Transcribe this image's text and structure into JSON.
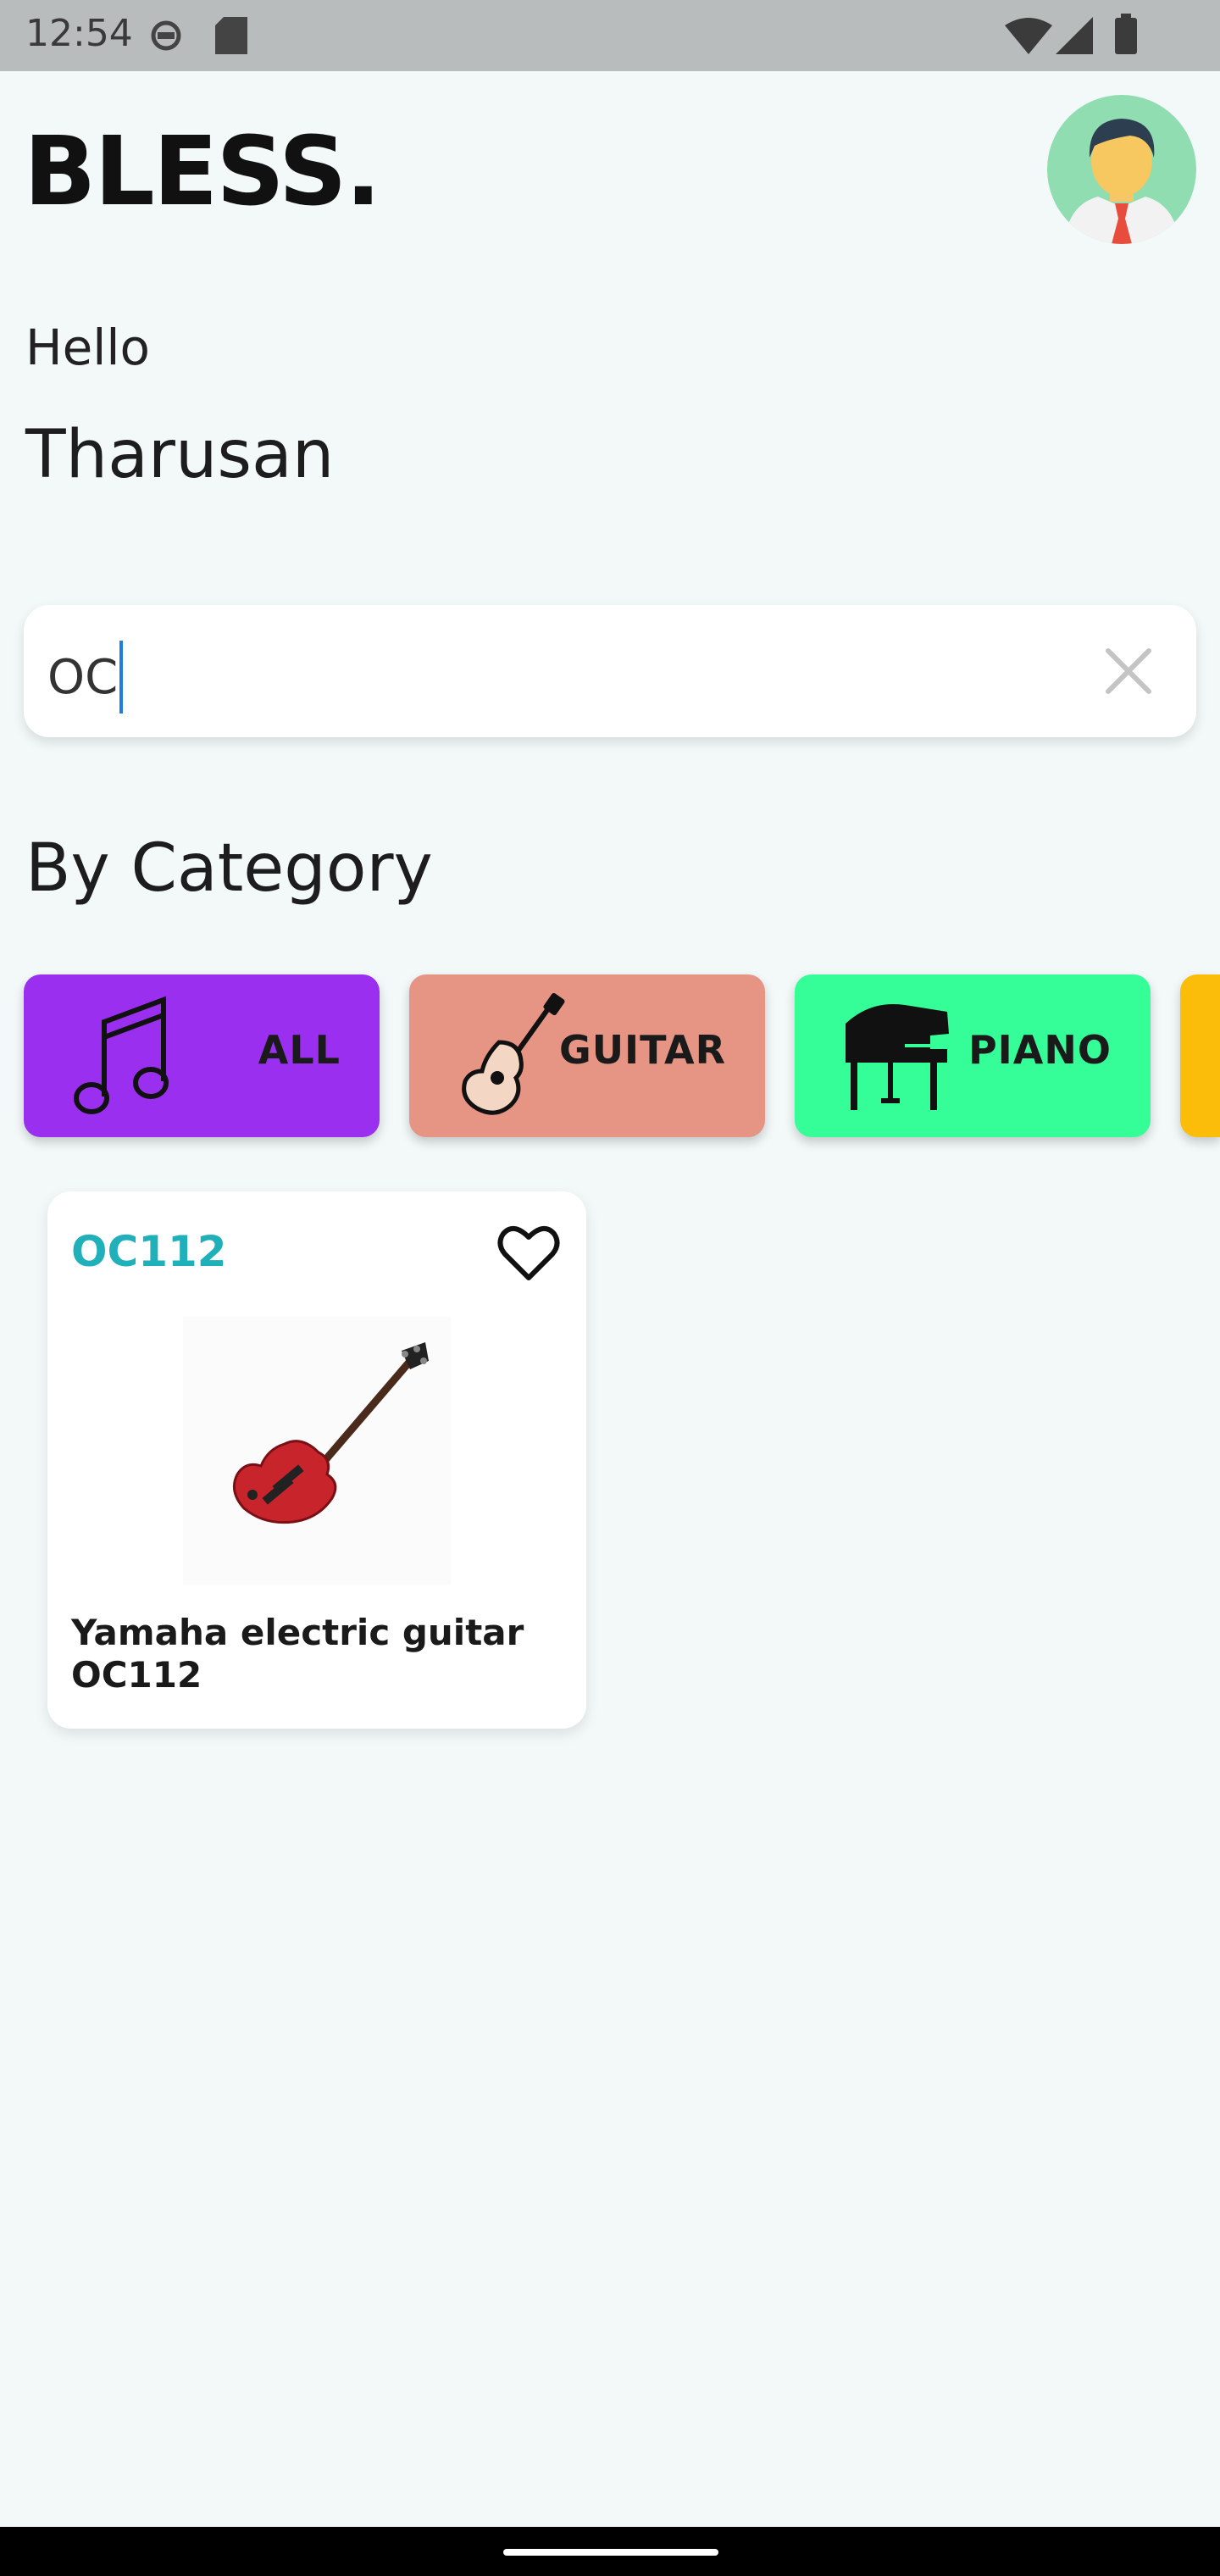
{
  "status_bar": {
    "time": "12:54"
  },
  "app": {
    "logo": "BLESS."
  },
  "greeting": {
    "hello": "Hello",
    "name": "Tharusan"
  },
  "search": {
    "value": "OC"
  },
  "categories_section": {
    "title": "By Category",
    "items": [
      {
        "label": "ALL",
        "icon": "music-note-icon",
        "color": "#9a2ff0"
      },
      {
        "label": "GUITAR",
        "icon": "guitar-icon",
        "color": "#e69484"
      },
      {
        "label": "PIANO",
        "icon": "piano-icon",
        "color": "#35fe98"
      },
      {
        "label": "",
        "icon": "",
        "color": "#fbbd0a"
      }
    ]
  },
  "products": [
    {
      "code": "OC112",
      "name": "Yamaha electric guitar OC112",
      "favorite_icon": "heart-outline-icon"
    }
  ],
  "colors": {
    "accent_code": "#1fb0ba",
    "cursor": "#1d7ee0",
    "background": "#f3f9f9"
  }
}
